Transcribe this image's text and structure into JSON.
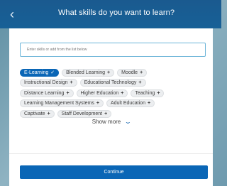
{
  "header": {
    "back_icon": "chevron-left-icon",
    "title": "What skills do you want to learn?"
  },
  "search": {
    "placeholder": "Enter skills or add from the list below"
  },
  "chips": [
    {
      "label": "E-Learning",
      "selected": true,
      "icon": "✓"
    },
    {
      "label": "Blended Learning",
      "selected": false,
      "icon": "+"
    },
    {
      "label": "Moodle",
      "selected": false,
      "icon": "+"
    },
    {
      "label": "Instructional Design",
      "selected": false,
      "icon": "+"
    },
    {
      "label": "Educational Technology",
      "selected": false,
      "icon": "+"
    },
    {
      "label": "Distance Learning",
      "selected": false,
      "icon": "+"
    },
    {
      "label": "Higher Education",
      "selected": false,
      "icon": "+"
    },
    {
      "label": "Teaching",
      "selected": false,
      "icon": "+"
    },
    {
      "label": "Learning Management Systems",
      "selected": false,
      "icon": "+"
    },
    {
      "label": "Adult Education",
      "selected": false,
      "icon": "+"
    },
    {
      "label": "Captivate",
      "selected": false,
      "icon": "+"
    },
    {
      "label": "Staff Development",
      "selected": false,
      "icon": "+"
    }
  ],
  "show_more": {
    "label": "Show more",
    "icon": "chevron-down-icon"
  },
  "continue_button": {
    "label": "Continue"
  },
  "colors": {
    "primary": "#0a66b6",
    "header": "#176097",
    "search_border": "#6ab4d8"
  }
}
